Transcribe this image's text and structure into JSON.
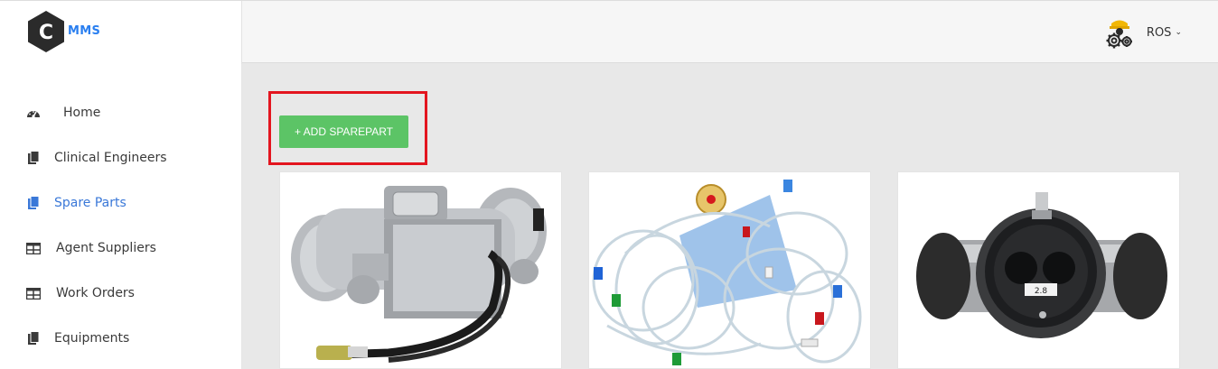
{
  "brand": {
    "logo_letter": "C",
    "name": "MMS"
  },
  "user": {
    "name": "ROS",
    "avatar_icon": "gear-worker-icon"
  },
  "sidebar": {
    "items": [
      {
        "label": "Home",
        "icon": "dashboard-icon",
        "active": false
      },
      {
        "label": "Clinical Engineers",
        "icon": "copy-icon",
        "active": false
      },
      {
        "label": "Spare Parts",
        "icon": "copy-icon",
        "active": true
      },
      {
        "label": "Agent Suppliers",
        "icon": "table-icon",
        "active": false
      },
      {
        "label": "Work Orders",
        "icon": "table-icon",
        "active": false
      },
      {
        "label": "Equipments",
        "icon": "copy-icon",
        "active": false
      }
    ]
  },
  "main": {
    "add_button_label": "+ ADD SPAREPART",
    "cards": [
      {
        "image": "pump-motor-image"
      },
      {
        "image": "tubing-set-image"
      },
      {
        "image": "optical-adapter-image"
      }
    ]
  },
  "colors": {
    "accent": "#3a78d8",
    "brand_text": "#2a7ff0",
    "button": "#5cc466",
    "highlight": "#e3151f"
  }
}
